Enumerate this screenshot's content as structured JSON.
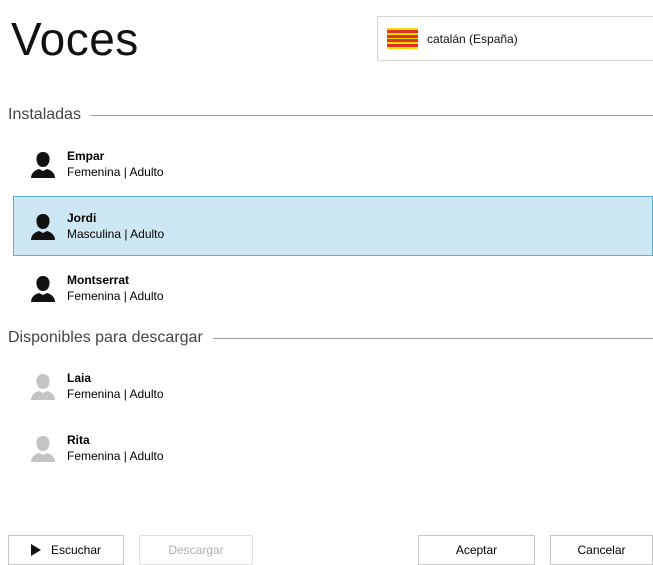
{
  "header": {
    "title": "Voces"
  },
  "language": {
    "flag_icon": "catalan-flag-icon",
    "label": "catalán (España)"
  },
  "sections": {
    "installed": {
      "label": "Instaladas"
    },
    "available": {
      "label": "Disponibles para descargar"
    }
  },
  "installed_voices": [
    {
      "name": "Empar",
      "desc": "Femenina | Adulto",
      "selected": false
    },
    {
      "name": "Jordi",
      "desc": "Masculina | Adulto",
      "selected": true
    },
    {
      "name": "Montserrat",
      "desc": "Femenina | Adulto",
      "selected": false
    }
  ],
  "available_voices": [
    {
      "name": "Laia",
      "desc": "Femenina | Adulto"
    },
    {
      "name": "Rita",
      "desc": "Femenina | Adulto"
    }
  ],
  "buttons": {
    "listen": "Escuchar",
    "download": "Descargar",
    "accept": "Aceptar",
    "cancel": "Cancelar"
  },
  "colors": {
    "selected_bg": "#cde8f4",
    "selected_border": "#5cb0d8",
    "installed_icon": "#111111",
    "available_icon": "#c4c4c4"
  }
}
